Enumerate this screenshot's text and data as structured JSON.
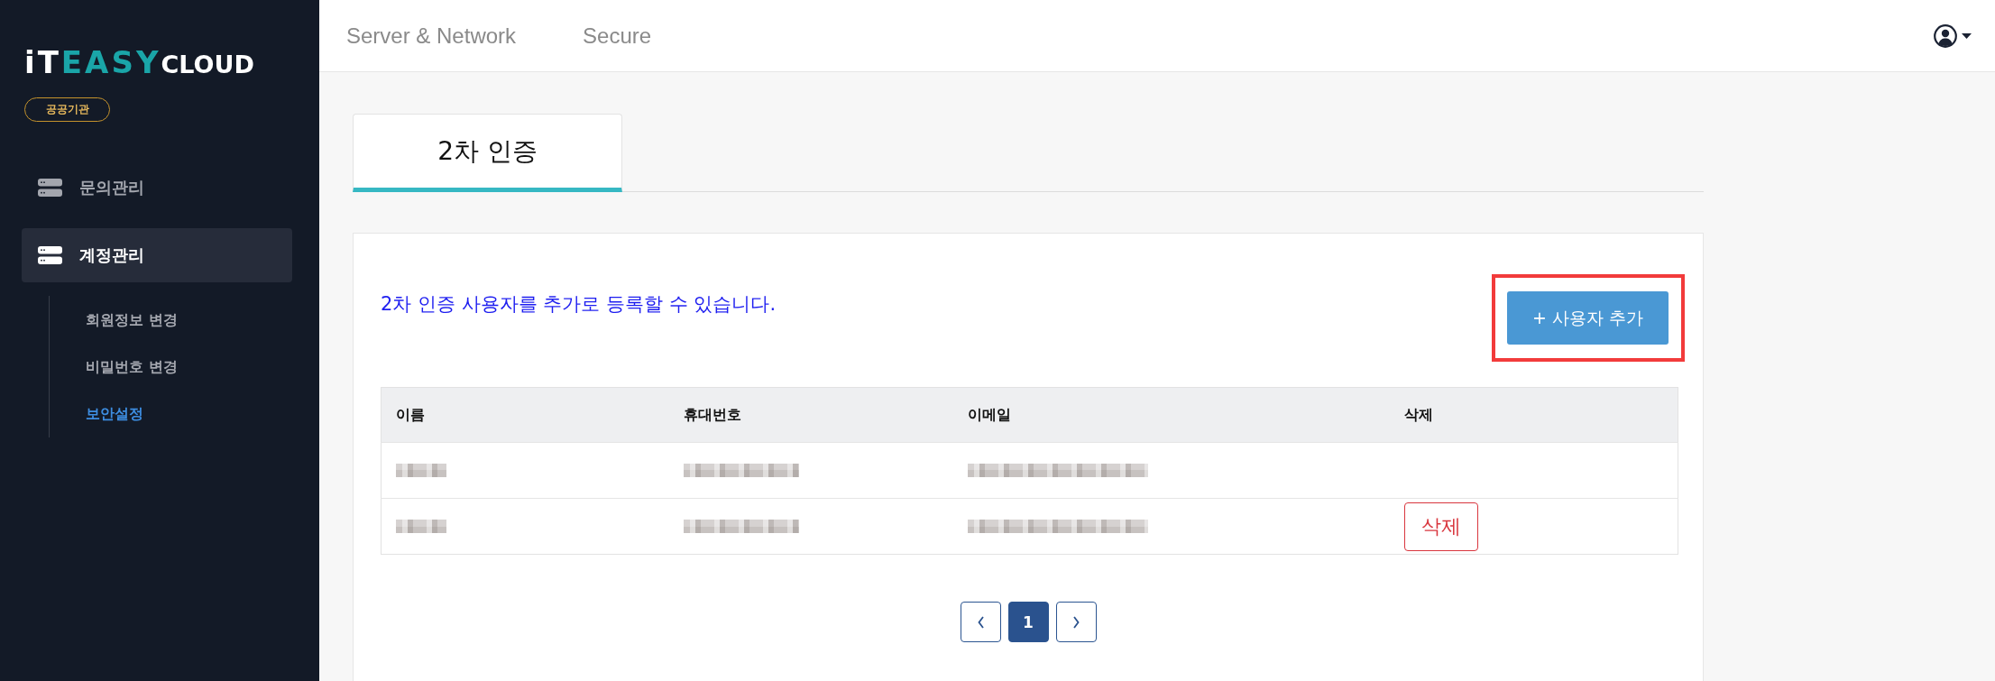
{
  "sidebar": {
    "logo": {
      "prefix": "iT",
      "highlight": "EASY",
      "suffix": "CLOUD"
    },
    "badge": "공공기관",
    "menu": [
      {
        "label": "문의관리",
        "selected": false
      },
      {
        "label": "계정관리",
        "selected": true,
        "children": [
          {
            "label": "회원정보 변경",
            "selected": false
          },
          {
            "label": "비밀번호 변경",
            "selected": false
          },
          {
            "label": "보안설정",
            "selected": true
          }
        ]
      }
    ]
  },
  "top_bar": {
    "nav": [
      "Server & Network",
      "Secure"
    ]
  },
  "tabs": [
    {
      "label": "2차 인증",
      "selected": true
    }
  ],
  "panel": {
    "description": "2차 인증 사용자를 추가로 등록할 수 있습니다.",
    "add_button": {
      "label": "+ 사용자 추가",
      "highlighted": true
    }
  },
  "table": {
    "columns": [
      "이름",
      "휴대번호",
      "이메일",
      "삭제"
    ],
    "rows": [
      {
        "redacted": true
      },
      {
        "redacted": true,
        "delete_button": "삭제"
      }
    ]
  },
  "pagination": {
    "pages": [
      {
        "label": "1",
        "selected": true
      }
    ]
  }
}
